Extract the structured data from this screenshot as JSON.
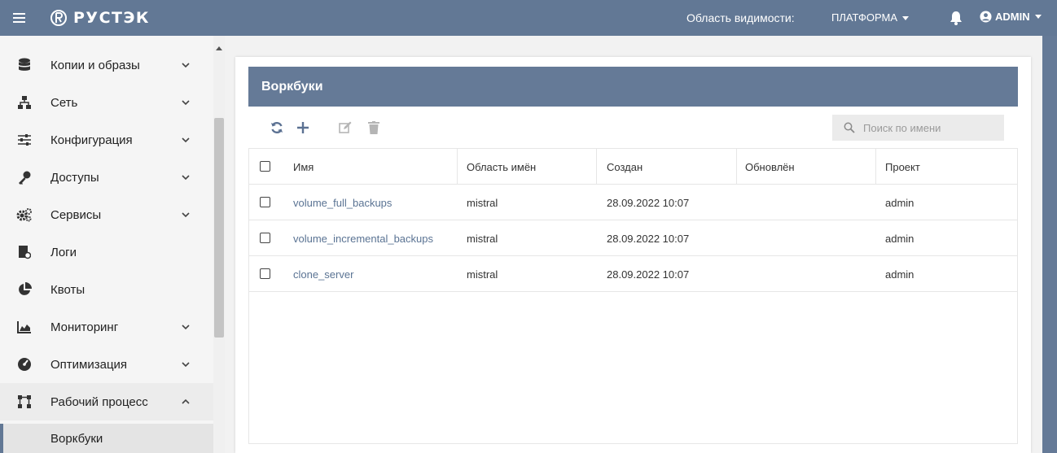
{
  "topbar": {
    "logo_text": "РУСТЭК",
    "scope_label": "Область видимости:",
    "scope_value": "ПЛАТФОРМА",
    "user": "ADMIN"
  },
  "sidebar": {
    "items": [
      {
        "label": "Копии и образы",
        "icon": "database-icon",
        "has_chevron": true
      },
      {
        "label": "Сеть",
        "icon": "network-icon",
        "has_chevron": true
      },
      {
        "label": "Конфигурация",
        "icon": "sliders-icon",
        "has_chevron": true
      },
      {
        "label": "Доступы",
        "icon": "key-icon",
        "has_chevron": true
      },
      {
        "label": "Сервисы",
        "icon": "cogs-icon",
        "has_chevron": true
      },
      {
        "label": "Логи",
        "icon": "logs-icon",
        "has_chevron": false
      },
      {
        "label": "Квоты",
        "icon": "pie-chart-icon",
        "has_chevron": false
      },
      {
        "label": "Мониторинг",
        "icon": "area-chart-icon",
        "has_chevron": true
      },
      {
        "label": "Оптимизация",
        "icon": "dashboard-icon",
        "has_chevron": true
      },
      {
        "label": "Рабочий процесс",
        "icon": "workflow-icon",
        "has_chevron": true,
        "expanded": true
      }
    ],
    "sub_item": "Воркбуки"
  },
  "page": {
    "title": "Воркбуки",
    "search_placeholder": "Поиск по имени"
  },
  "table": {
    "columns": [
      "Имя",
      "Область имён",
      "Создан",
      "Обновлён",
      "Проект"
    ],
    "rows": [
      {
        "name": "volume_full_backups",
        "namespace": "mistral",
        "created": "28.09.2022 10:07",
        "updated": "",
        "project": "admin"
      },
      {
        "name": "volume_incremental_backups",
        "namespace": "mistral",
        "created": "28.09.2022 10:07",
        "updated": "",
        "project": "admin"
      },
      {
        "name": "clone_server",
        "namespace": "mistral",
        "created": "28.09.2022 10:07",
        "updated": "",
        "project": "admin"
      }
    ]
  },
  "colors": {
    "brand": "#627895",
    "link": "#5a7393"
  }
}
